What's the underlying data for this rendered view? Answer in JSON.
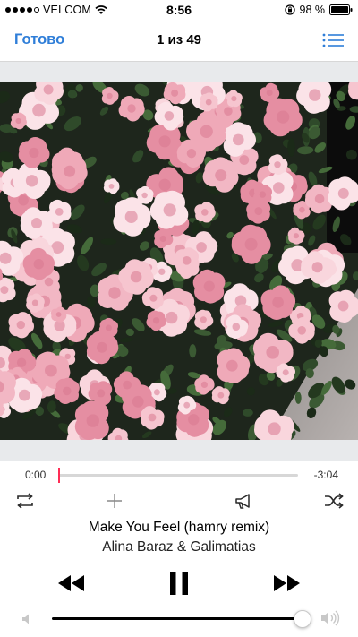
{
  "status_bar": {
    "carrier": "VELCOM",
    "time": "8:56",
    "battery_percent": "98 %",
    "signal_bars_filled": 4,
    "signal_bars_total": 5
  },
  "nav": {
    "done_label": "Готово",
    "track_counter": "1 из 49"
  },
  "artwork": {
    "description_icon": "album-art"
  },
  "progress": {
    "elapsed": "0:00",
    "remaining": "-3:04",
    "fraction": 0.003
  },
  "controls": {
    "repeat_icon": "repeat-icon",
    "add_icon": "plus-icon",
    "share_icon": "megaphone-icon",
    "shuffle_icon": "shuffle-icon"
  },
  "song": {
    "title": "Make You Feel (hamry remix)",
    "artist": "Alina Baraz & Galimatias"
  },
  "transport": {
    "rewind_icon": "rewind-icon",
    "pause_icon": "pause-icon",
    "forward_icon": "fast-forward-icon"
  },
  "volume": {
    "level": 0.99
  },
  "colors": {
    "accent": "#2f7ed8",
    "progress": "#ff2d55",
    "band": "#e8eaec"
  }
}
